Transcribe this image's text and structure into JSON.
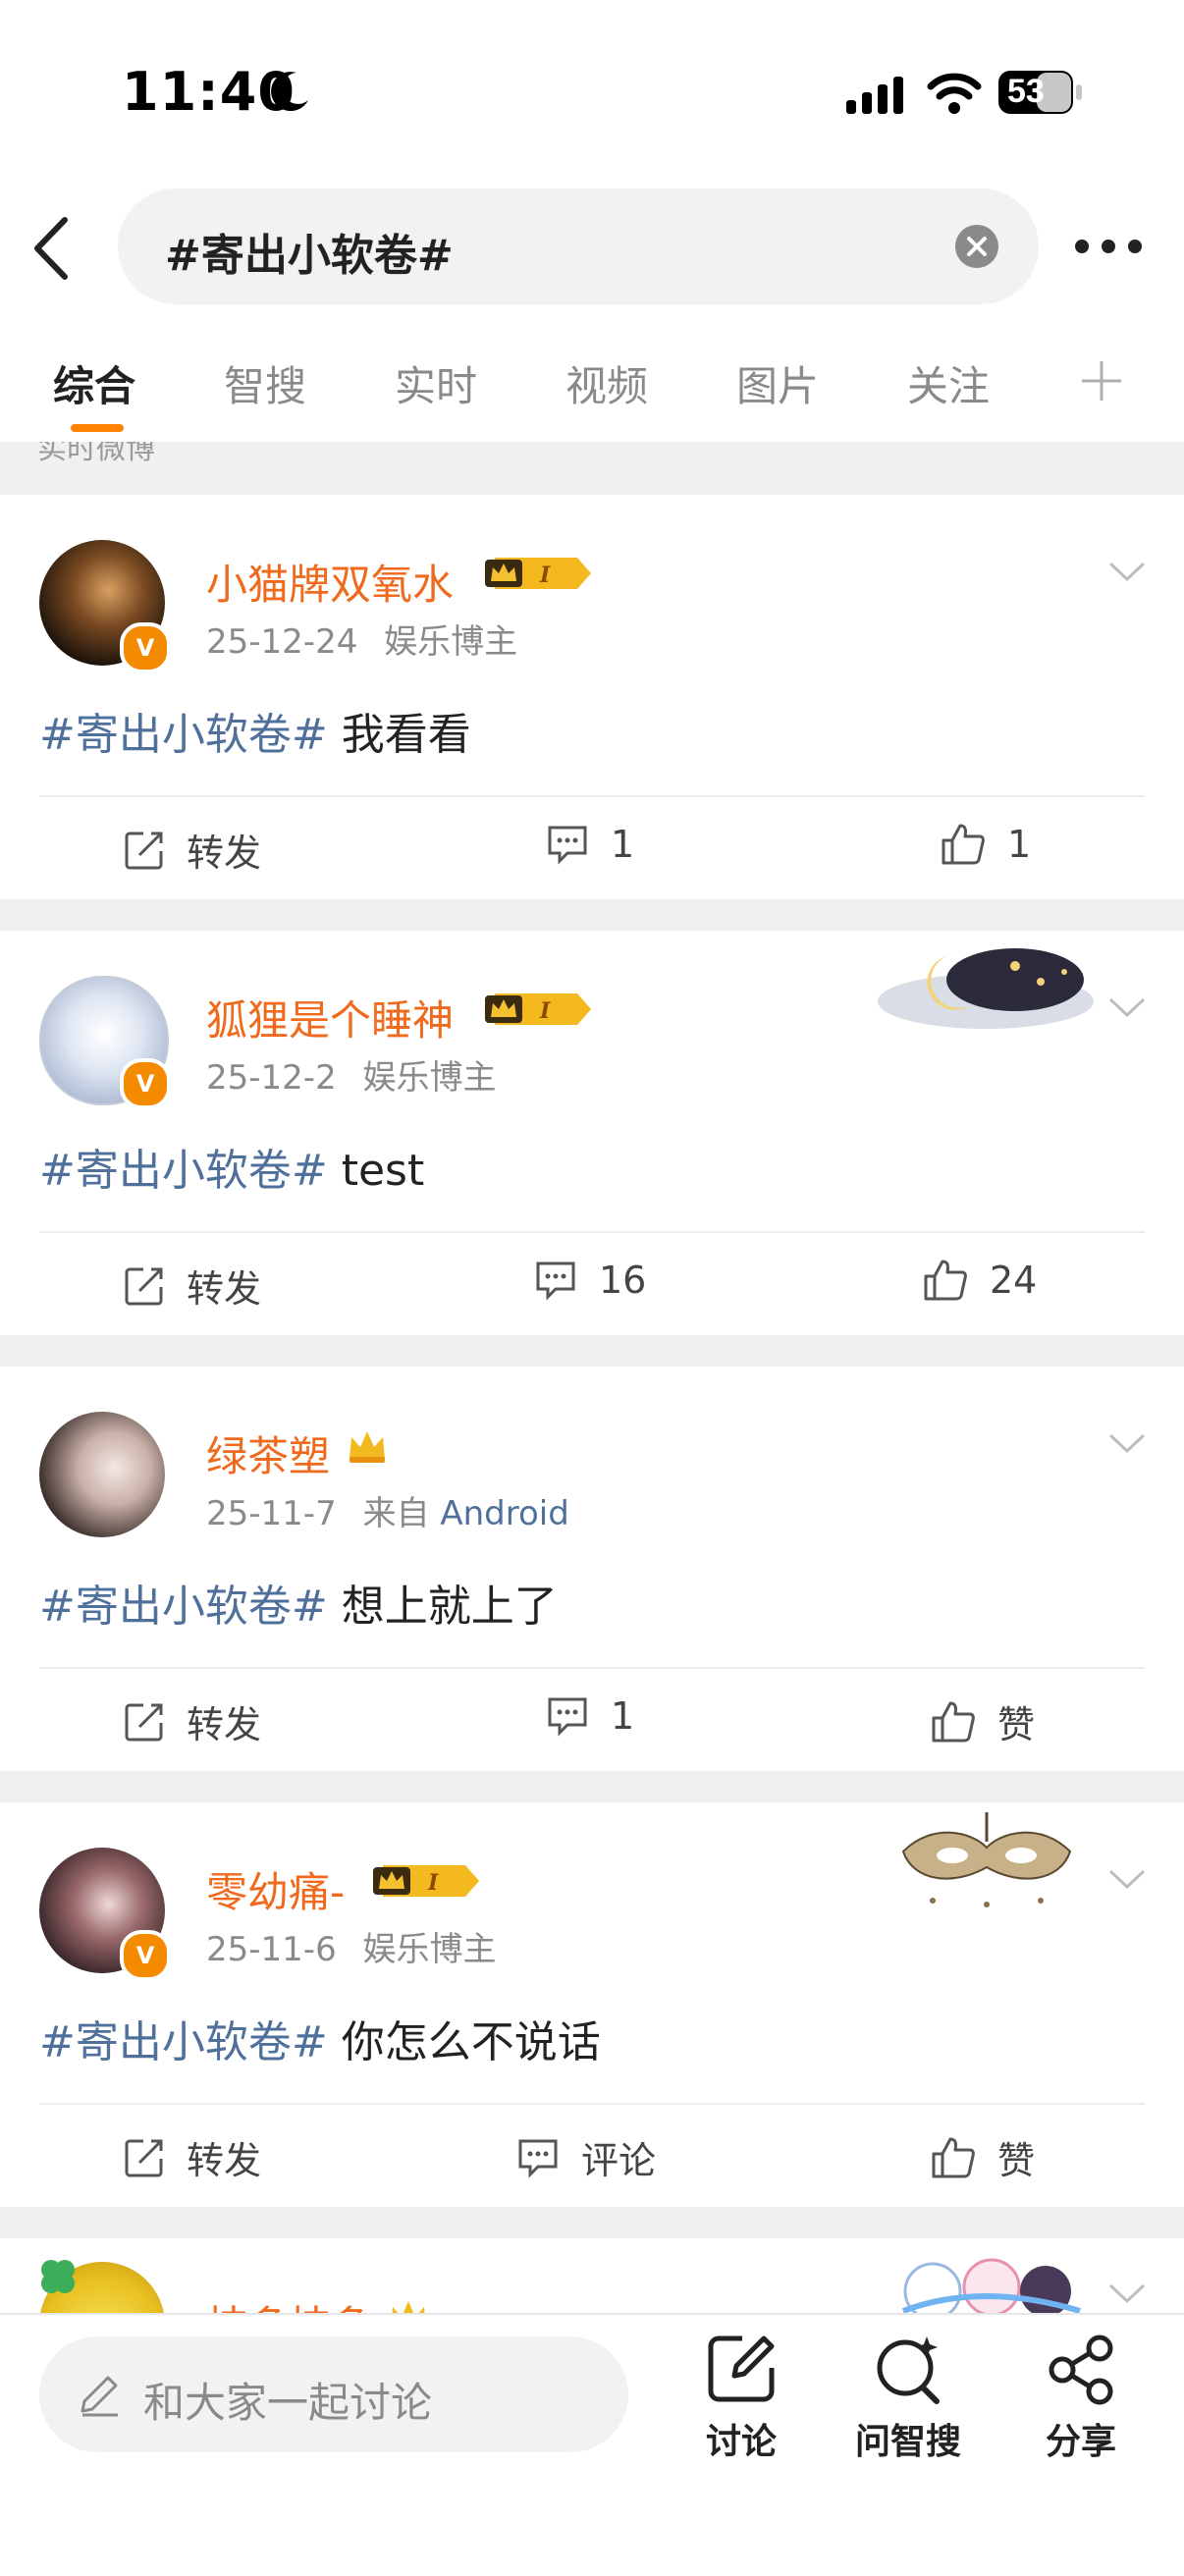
{
  "status_bar": {
    "time": "11:40",
    "battery": "53"
  },
  "search": {
    "query": "#寄出小软卷#"
  },
  "tabs": [
    {
      "label": "综合",
      "active": true
    },
    {
      "label": "智搜"
    },
    {
      "label": "实时"
    },
    {
      "label": "视频"
    },
    {
      "label": "图片"
    },
    {
      "label": "关注"
    }
  ],
  "section_label": "实时微博",
  "posts": [
    {
      "username": "小猫牌双氧水",
      "date": "25-12-24",
      "source": "娱乐博主",
      "hashtag": "#寄出小软卷#",
      "text": " 我看看",
      "repost": "转发",
      "comments": "1",
      "likes": "1"
    },
    {
      "username": "狐狸是个睡神",
      "date": "25-12-2",
      "source": "娱乐博主",
      "hashtag": "#寄出小软卷#",
      "text": " test",
      "repost": "转发",
      "comments": "16",
      "likes": "24"
    },
    {
      "username": "绿茶塑",
      "date": "25-11-7",
      "source_prefix": "来自",
      "source": "Android",
      "hashtag": "#寄出小软卷#",
      "text": " 想上就上了",
      "repost": "转发",
      "comments": "1",
      "likes": "赞"
    },
    {
      "username": "零幼痛-",
      "date": "25-11-6",
      "source": "娱乐博主",
      "hashtag": "#寄出小软卷#",
      "text": " 你怎么不说话",
      "repost": "转发",
      "comments": "评论",
      "likes": "赞"
    },
    {
      "username": "桔多桔多"
    }
  ],
  "bottom_bar": {
    "input_placeholder": "和大家一起讨论",
    "discuss": "讨论",
    "ask": "问智搜",
    "share": "分享"
  },
  "colors": {
    "accent": "#ff8200",
    "username": "#f06a1e",
    "hashtag": "#50709c"
  }
}
